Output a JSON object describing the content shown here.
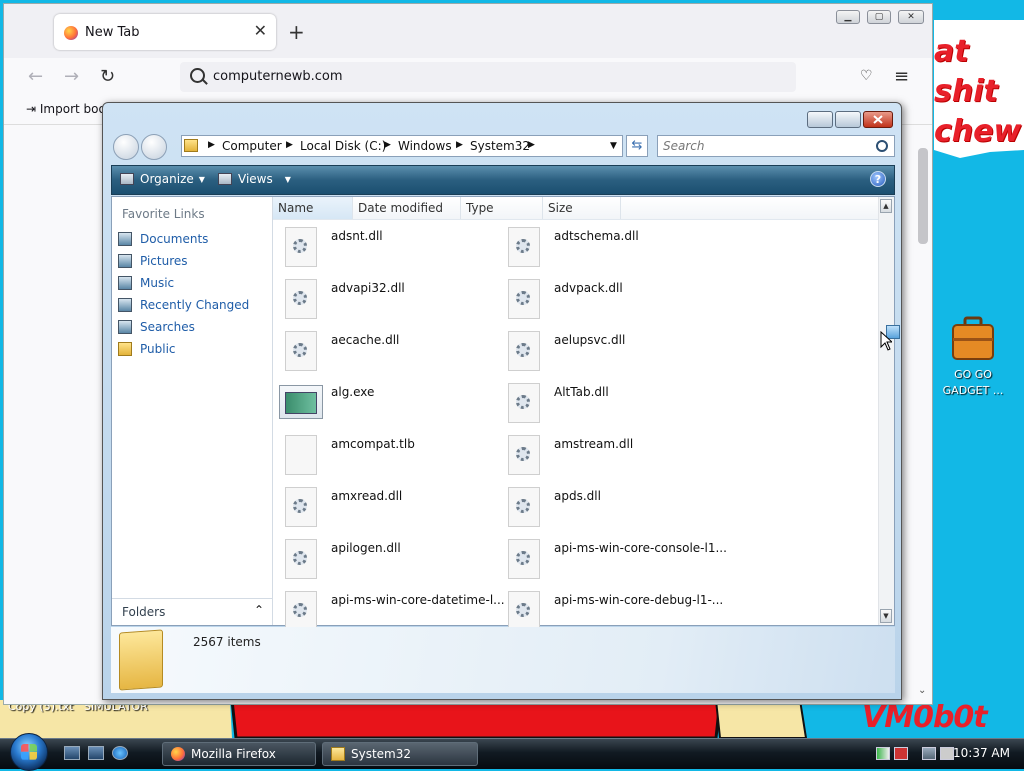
{
  "desktop": {
    "wallpaper_text": [
      "at shit",
      "chew"
    ],
    "signature": "VM0b0t",
    "gadget_label_1": "GO GO",
    "gadget_label_2": "GADGET ...",
    "bottom_labels": [
      "Copy (5).txt",
      "SIMULATOR"
    ]
  },
  "firefox": {
    "tab_title": "New Tab",
    "url": "computernewb.com",
    "bookmarks_item": "Import boo"
  },
  "explorer": {
    "breadcrumbs": [
      "Computer",
      "Local Disk (C:)",
      "Windows",
      "System32"
    ],
    "search_placeholder": "Search",
    "toolbar": {
      "organize": "Organize",
      "views": "Views"
    },
    "favorite_links_header": "Favorite Links",
    "favorite_links": [
      "Documents",
      "Pictures",
      "Music",
      "Recently Changed",
      "Searches",
      "Public"
    ],
    "folders_label": "Folders",
    "columns": [
      "Name",
      "Date modified",
      "Type",
      "Size"
    ],
    "files": [
      {
        "name": "adsnt.dll",
        "icon": "dll"
      },
      {
        "name": "adtschema.dll",
        "icon": "dll"
      },
      {
        "name": "advapi32.dll",
        "icon": "dll"
      },
      {
        "name": "advpack.dll",
        "icon": "dll"
      },
      {
        "name": "aecache.dll",
        "icon": "dll"
      },
      {
        "name": "aelupsvc.dll",
        "icon": "dll"
      },
      {
        "name": "alg.exe",
        "icon": "exe"
      },
      {
        "name": "AltTab.dll",
        "icon": "dll"
      },
      {
        "name": "amcompat.tlb",
        "icon": "blank"
      },
      {
        "name": "amstream.dll",
        "icon": "dll"
      },
      {
        "name": "amxread.dll",
        "icon": "dll"
      },
      {
        "name": "apds.dll",
        "icon": "dll"
      },
      {
        "name": "apilogen.dll",
        "icon": "dll"
      },
      {
        "name": "api-ms-win-core-console-l1...",
        "icon": "dll"
      },
      {
        "name": "api-ms-win-core-datetime-l...",
        "icon": "dll"
      },
      {
        "name": "api-ms-win-core-debug-l1-...",
        "icon": "dll"
      }
    ],
    "item_count": "2567 items"
  },
  "taskbar": {
    "tasks": [
      "Mozilla Firefox",
      "System32"
    ],
    "clock": "10:37 AM"
  }
}
